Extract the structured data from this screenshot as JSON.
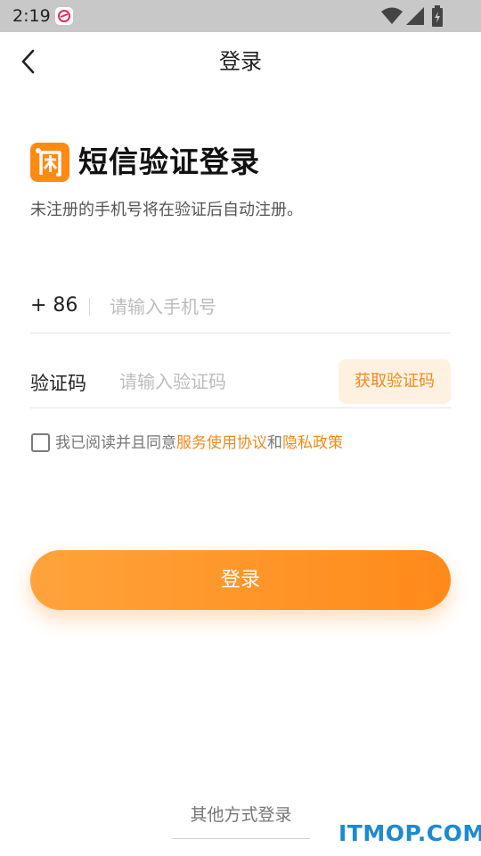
{
  "status_bar": {
    "time": "2:19",
    "icons": [
      "app-notification-icon",
      "wifi-icon",
      "signal-icon",
      "battery-icon"
    ]
  },
  "nav": {
    "title": "登录"
  },
  "header": {
    "logo_text": "闲",
    "title": "短信验证登录",
    "subtitle": "未注册的手机号将在验证后自动注册。"
  },
  "phone": {
    "country_code": "+ 86",
    "placeholder": "请输入手机号",
    "value": ""
  },
  "verification": {
    "label": "验证码",
    "placeholder": "请输入验证码",
    "value": "",
    "get_code_label": "获取验证码"
  },
  "agreement": {
    "checked": false,
    "prefix": "我已阅读并且同意",
    "service_link": "服务使用协议",
    "and": "和",
    "privacy_link": "隐私政策"
  },
  "login_button": "登录",
  "other_login": "其他方式登录",
  "watermark": "ITMOP.COM",
  "colors": {
    "accent": "#ff8a1a",
    "link": "#f08a1d",
    "status_bar": "#c8c8c8"
  }
}
